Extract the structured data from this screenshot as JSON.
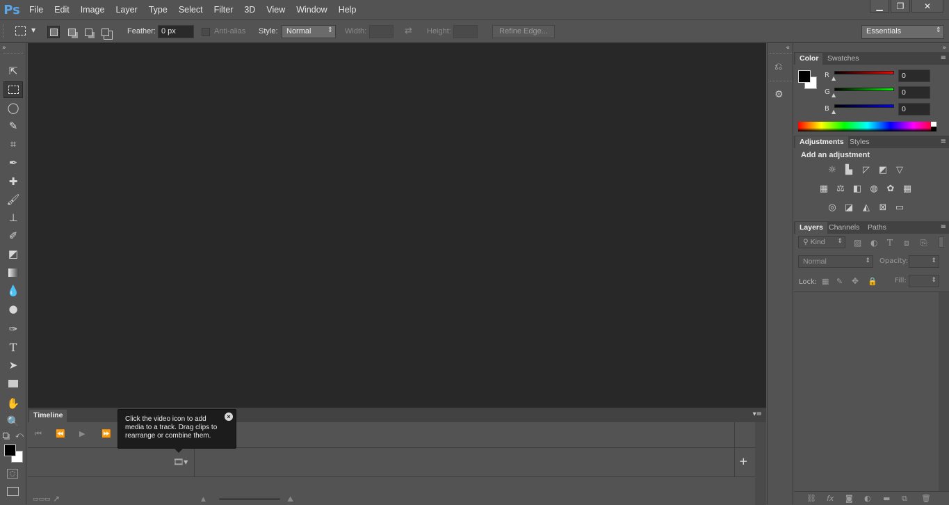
{
  "app": {
    "logo": "Ps"
  },
  "menu": [
    "File",
    "Edit",
    "Image",
    "Layer",
    "Type",
    "Select",
    "Filter",
    "3D",
    "View",
    "Window",
    "Help"
  ],
  "window_controls": {
    "minimize": "▁",
    "restore": "❐",
    "close": "✕"
  },
  "options": {
    "feather_label": "Feather:",
    "feather_value": "0 px",
    "antialias_label": "Anti-alias",
    "style_label": "Style:",
    "style_value": "Normal",
    "width_label": "Width:",
    "height_label": "Height:",
    "refine_edge": "Refine Edge...",
    "workspace": "Essentials"
  },
  "timeline": {
    "tab": "Timeline",
    "tooltip": "Click the video icon to add media to a track. Drag clips to rearrange or combine them."
  },
  "color_panel": {
    "tabs": [
      "Color",
      "Swatches"
    ],
    "channels": [
      {
        "label": "R",
        "value": "0",
        "color": "#ff0000"
      },
      {
        "label": "G",
        "value": "0",
        "color": "#00ff00"
      },
      {
        "label": "B",
        "value": "0",
        "color": "#0000ff"
      }
    ]
  },
  "adjustments_panel": {
    "tabs": [
      "Adjustments",
      "Styles"
    ],
    "heading": "Add an adjustment"
  },
  "layers_panel": {
    "tabs": [
      "Layers",
      "Channels",
      "Paths"
    ],
    "kind_filter": "Kind",
    "blend_mode": "Normal",
    "opacity_label": "Opacity:",
    "lock_label": "Lock:",
    "fill_label": "Fill:"
  },
  "colors": {
    "foreground": "#000000",
    "background": "#ffffff",
    "canvas": "#282828",
    "ui": "#535353"
  }
}
